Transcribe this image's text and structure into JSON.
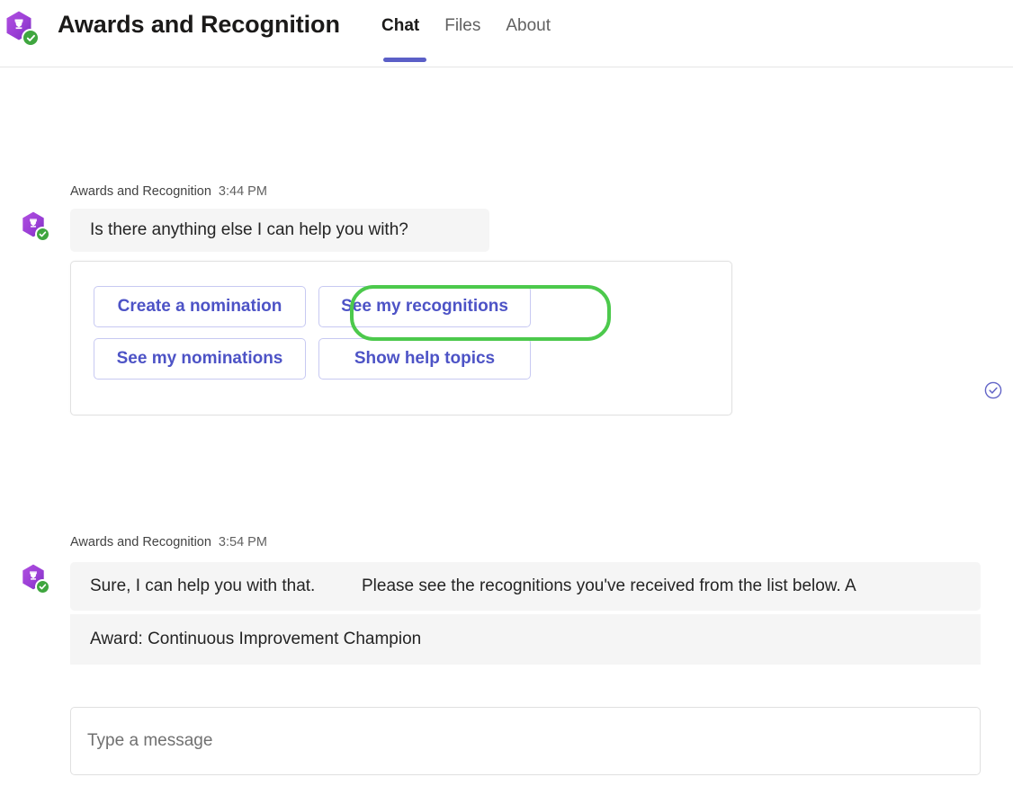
{
  "header": {
    "app_title": "Awards and Recognition",
    "app_icon": "trophy-hexagon-icon",
    "presence_icon": "available-check-icon",
    "tabs": [
      {
        "label": "Chat",
        "active": true
      },
      {
        "label": "Files",
        "active": false
      },
      {
        "label": "About",
        "active": false
      }
    ],
    "accent_color": "#5b5fc7"
  },
  "conversation": {
    "messages": [
      {
        "sender": "Awards and Recognition",
        "time": "3:44 PM",
        "text": "Is there anything else I can help you with?",
        "avatar_icon": "trophy-hexagon-icon"
      },
      {
        "sender": "Awards and Recognition",
        "time": "3:54 PM",
        "text": "Sure, I can help you with that.",
        "text_overflow": "Please see the recognitions you've received from the list below. A",
        "text_second": "Award: Continuous Improvement Champion",
        "avatar_icon": "trophy-hexagon-icon"
      }
    ],
    "suggested_actions": {
      "buttons": [
        {
          "label": "Create a nomination",
          "highlighted": false
        },
        {
          "label": "See my recognitions",
          "highlighted": true
        },
        {
          "label": "See my nominations",
          "highlighted": false
        },
        {
          "label": "Show help topics",
          "highlighted": false
        }
      ],
      "button_text_color": "#4d53c6",
      "button_border_color": "#c7c9f2",
      "highlight_color": "#4cc94c"
    },
    "delivered_indicator": {
      "icon": "check-circle-icon",
      "color": "#5b5fc7"
    }
  },
  "compose": {
    "placeholder": "Type a message",
    "value": ""
  }
}
